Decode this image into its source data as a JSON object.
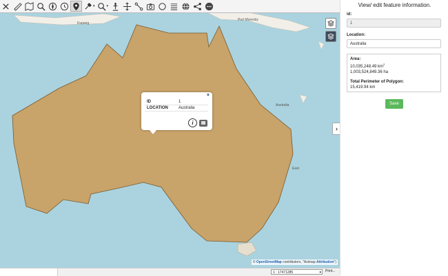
{
  "toolbar": {
    "icons": [
      "close-x-icon",
      "ruler-icon",
      "map-icon",
      "search-zoom-icon",
      "compass-icon",
      "history-icon",
      "location-pin-icon",
      "tools-icon",
      "zoom-icon",
      "geocache-icon",
      "move-icon",
      "line-icon",
      "camera-icon",
      "circle-icon",
      "list-icon",
      "globe-icon",
      "share-icon",
      "more-icon"
    ],
    "active": "location-pin-icon"
  },
  "map": {
    "labels": {
      "kupang": "Kupang",
      "port_moresby": "Port Moresby",
      "australia_sea": "Australia",
      "east": "East"
    },
    "attribution": {
      "prefix": "© ",
      "osm": "OpenStreetMap",
      "middle": " contributors, \"Azimap ",
      "attr": "Attribution",
      "suffix": "\")"
    },
    "colors": {
      "water": "#aad3df",
      "polygon_fill": "#c8a36a",
      "polygon_stroke": "#7a5a2e"
    }
  },
  "popup": {
    "rows": [
      {
        "key": "ID",
        "value": "1"
      },
      {
        "key": "LOCATION",
        "value": "Australia"
      }
    ],
    "close": "×",
    "info": "i"
  },
  "footer": {
    "scale": "1 : 17471285",
    "print": "Print..."
  },
  "panel": {
    "title": "View/ edit feature information.",
    "id_label": "id:",
    "id_value": "1",
    "location_label": "Location:",
    "location_value": "Australia",
    "area_label": "Area:",
    "area_km2": "10,035,248.49 km",
    "area_km2_sup": "2",
    "area_ha": "1,003,524,849.36 ha",
    "perimeter_label": "Total Perimeter of Polygon:",
    "perimeter_value": "15,419.94 km",
    "save_label": "Save",
    "expand_glyph": "›"
  }
}
